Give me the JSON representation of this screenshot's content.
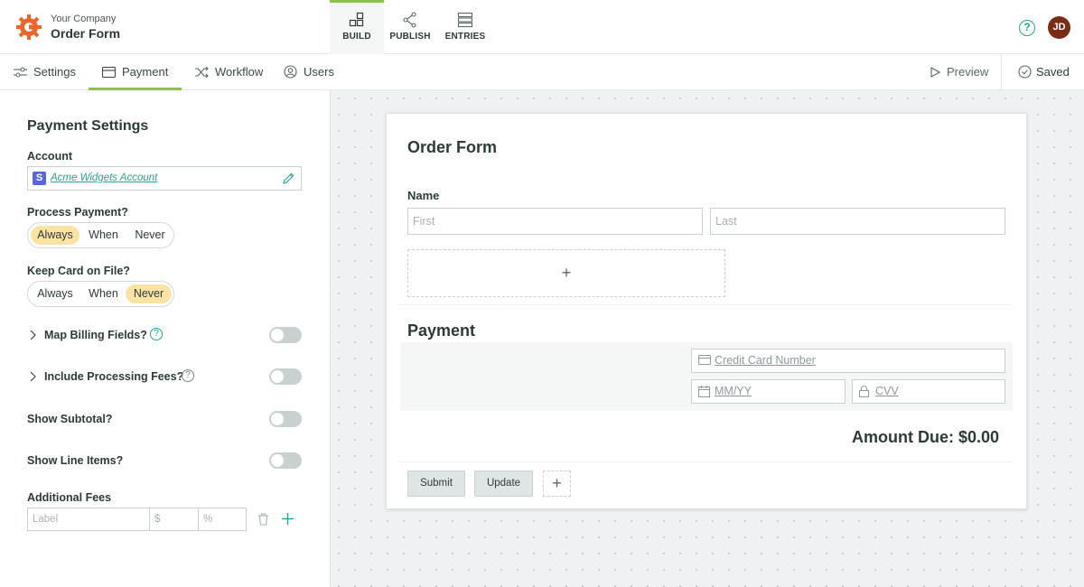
{
  "header": {
    "company": "Your Company",
    "form_name": "Order Form",
    "modes": [
      {
        "label": "BUILD",
        "icon": "blocks-icon"
      },
      {
        "label": "PUBLISH",
        "icon": "share-icon"
      },
      {
        "label": "ENTRIES",
        "icon": "list-icon"
      }
    ],
    "user_initials": "JD",
    "accent_color": "#8bc34a",
    "brand_color": "#e8652c",
    "avatar_color": "#7a2d15"
  },
  "subnav": {
    "tabs": [
      {
        "label": "Settings",
        "icon": "sliders-icon"
      },
      {
        "label": "Payment",
        "icon": "card-icon"
      },
      {
        "label": "Workflow",
        "icon": "shuffle-icon"
      },
      {
        "label": "Users",
        "icon": "user-icon"
      }
    ],
    "active_tab": "Payment",
    "preview_label": "Preview",
    "saved_label": "Saved"
  },
  "panel": {
    "title": "Payment Settings",
    "account_label": "Account",
    "account_value": "Acme Widgets Account",
    "process_label": "Process Payment?",
    "process_options": [
      "Always",
      "When",
      "Never"
    ],
    "process_selected": "Always",
    "keep_label": "Keep Card on File?",
    "keep_options": [
      "Always",
      "When",
      "Never"
    ],
    "keep_selected": "Never",
    "map_billing_label": "Map Billing Fields?",
    "processing_fees_label": "Include Processing Fees?",
    "show_subtotal_label": "Show Subtotal?",
    "show_line_items_label": "Show Line Items?",
    "toggles_on": [
      false,
      false,
      false,
      false
    ],
    "additional_fees_label": "Additional Fees",
    "fee_label_placeholder": "Label",
    "fee_dollar_placeholder": "$",
    "fee_percent_placeholder": "%"
  },
  "form": {
    "title": "Order Form",
    "name_label": "Name",
    "first_placeholder": "First",
    "last_placeholder": "Last",
    "payment_heading": "Payment",
    "card_number_placeholder": "Credit Card Number",
    "expiry_placeholder": "MM/YY",
    "cvv_placeholder": "CVV",
    "amount_due": "Amount Due: $0.00",
    "submit_label": "Submit",
    "update_label": "Update"
  }
}
